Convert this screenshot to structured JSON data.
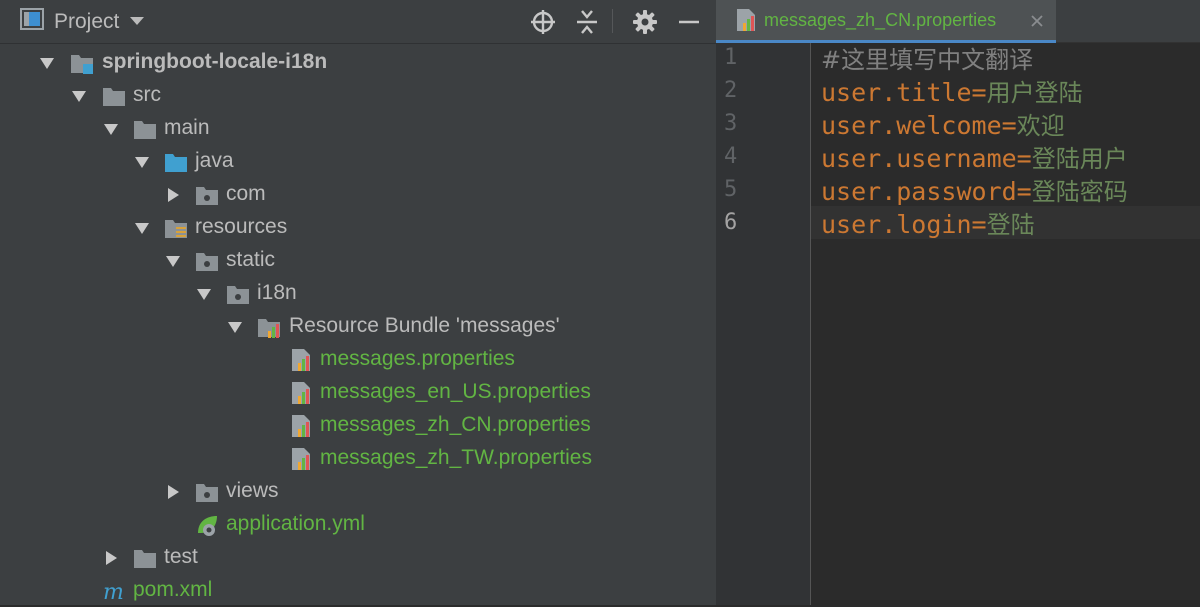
{
  "project_panel": {
    "title": "Project",
    "tools": [
      "locate-icon",
      "collapse-all-icon",
      "gear-icon",
      "minimize-icon"
    ]
  },
  "tree": [
    {
      "label": "springboot-locale-i18n",
      "icon": "module-folder-icon",
      "expanded": true,
      "bold": true,
      "green": false
    },
    {
      "label": "src",
      "icon": "folder-icon",
      "expanded": true,
      "bold": false,
      "green": false
    },
    {
      "label": "main",
      "icon": "folder-icon",
      "expanded": true,
      "bold": false,
      "green": false
    },
    {
      "label": "java",
      "icon": "source-folder-icon",
      "expanded": true,
      "bold": false,
      "green": false
    },
    {
      "label": "com",
      "icon": "package-icon",
      "expanded": false,
      "bold": false,
      "green": false
    },
    {
      "label": "resources",
      "icon": "resources-folder-icon",
      "expanded": true,
      "bold": false,
      "green": false
    },
    {
      "label": "static",
      "icon": "package-icon",
      "expanded": true,
      "bold": false,
      "green": false
    },
    {
      "label": "i18n",
      "icon": "package-icon",
      "expanded": true,
      "bold": false,
      "green": false
    },
    {
      "label": "Resource Bundle 'messages'",
      "icon": "resource-bundle-icon",
      "expanded": true,
      "bold": false,
      "green": false
    },
    {
      "label": "messages.properties",
      "icon": "properties-file-icon",
      "expanded": null,
      "bold": false,
      "green": true
    },
    {
      "label": "messages_en_US.properties",
      "icon": "properties-file-icon",
      "expanded": null,
      "bold": false,
      "green": true
    },
    {
      "label": "messages_zh_CN.properties",
      "icon": "properties-file-icon",
      "expanded": null,
      "bold": false,
      "green": true
    },
    {
      "label": "messages_zh_TW.properties",
      "icon": "properties-file-icon",
      "expanded": null,
      "bold": false,
      "green": true
    },
    {
      "label": "views",
      "icon": "package-icon",
      "expanded": false,
      "bold": false,
      "green": false
    },
    {
      "label": "application.yml",
      "icon": "spring-yml-icon",
      "expanded": null,
      "bold": false,
      "green": true
    },
    {
      "label": "test",
      "icon": "folder-icon",
      "expanded": false,
      "bold": false,
      "green": false
    },
    {
      "label": "pom.xml",
      "icon": "maven-icon",
      "expanded": null,
      "bold": false,
      "green": true
    }
  ],
  "editor": {
    "tab_label": "messages_zh_CN.properties",
    "current_line": 6,
    "lines": [
      {
        "number": "1",
        "comment": "#这里填写中文翻译"
      },
      {
        "number": "2",
        "key": "user.title",
        "eq": "=",
        "value": "用户登陆"
      },
      {
        "number": "3",
        "key": "user.welcome",
        "eq": "=",
        "value": "欢迎"
      },
      {
        "number": "4",
        "key": "user.username",
        "eq": "=",
        "value": "登陆用户"
      },
      {
        "number": "5",
        "key": "user.password",
        "eq": "=",
        "value": "登陆密码"
      },
      {
        "number": "6",
        "key": "user.login",
        "eq": "=",
        "value": "登陆"
      }
    ]
  },
  "colors": {
    "panel_bg": "#3c3f41",
    "editor_bg": "#2b2b2b",
    "vcs_added_green": "#62b543",
    "key_orange": "#cc7832",
    "value_green": "#6a8759",
    "comment_gray": "#808080",
    "folder_blue": "#40a0d0"
  }
}
